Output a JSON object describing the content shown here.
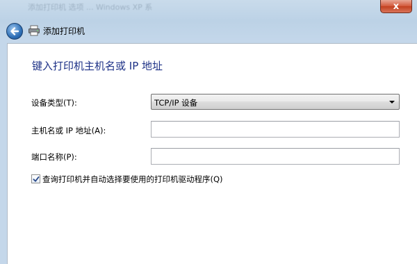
{
  "window": {
    "title_text": "添加打印机  选项 ... Windows XP 系",
    "close_label": "x"
  },
  "nav": {
    "title": "添加打印机",
    "back_icon": "back-arrow-icon",
    "printer_icon": "printer-icon"
  },
  "main": {
    "heading": "键入打印机主机名或 IP 地址",
    "device_type": {
      "label": "设备类型(T):",
      "value": "TCP/IP 设备"
    },
    "hostname": {
      "label": "主机名或 IP 地址(A):",
      "value": ""
    },
    "port_name": {
      "label": "端口名称(P):",
      "value": ""
    },
    "query_checkbox": {
      "label": "查询打印机并自动选择要使用的打印机驱动程序(Q)",
      "checked": true
    }
  },
  "colors": {
    "heading": "#1e3287",
    "frame": "#c4d7ea",
    "close_button": "#c2401f"
  }
}
